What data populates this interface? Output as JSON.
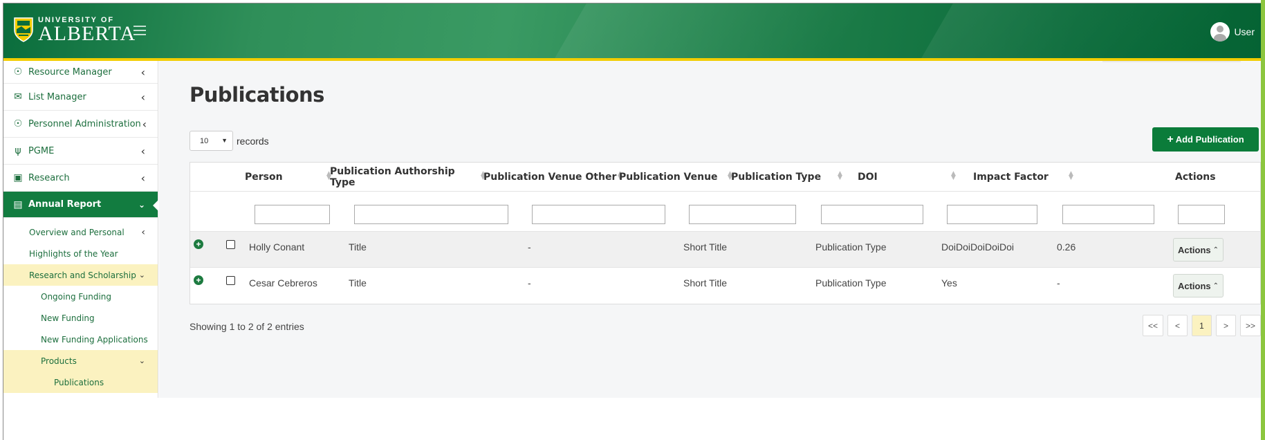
{
  "header": {
    "logo_top": "UNIVERSITY OF",
    "logo_main": "ALBERTA",
    "user_label": "User"
  },
  "sidebar": {
    "items": [
      {
        "label": "Resource Manager",
        "icon": "user-search-icon"
      },
      {
        "label": "List Manager",
        "icon": "envelope-icon"
      },
      {
        "label": "Personnel Administration",
        "icon": "user-search-icon"
      },
      {
        "label": "PGME",
        "icon": "stethoscope-icon"
      },
      {
        "label": "Research",
        "icon": "archive-icon"
      },
      {
        "label": "Annual Report",
        "icon": "book-open-icon"
      }
    ],
    "sub_items": [
      {
        "label": "Overview and Personal"
      },
      {
        "label": "Highlights of the Year"
      },
      {
        "label": "Research and Scholarship"
      },
      {
        "label": "Ongoing Funding"
      },
      {
        "label": "New Funding"
      },
      {
        "label": "New Funding Applications"
      },
      {
        "label": "Products"
      },
      {
        "label": "Publications"
      }
    ]
  },
  "main": {
    "title": "Publications",
    "records_value": "10",
    "records_label": "records",
    "add_button": "Add Publication",
    "columns": [
      "Person",
      "Publication Authorship Type",
      "Publication Venue Other",
      "Publication Venue",
      "Publication Type",
      "DOI",
      "Impact Factor",
      "Actions"
    ],
    "rows": [
      {
        "person": "Holly Conant",
        "authorship": "Title",
        "venue_other": "-",
        "venue": "Short Title",
        "type": "Publication Type",
        "doi": "DoiDoiDoiDoiDoi",
        "impact": "0.26",
        "action": "Actions"
      },
      {
        "person": "Cesar Cebreros",
        "authorship": "Title",
        "venue_other": "-",
        "venue": "Short Title",
        "type": "Publication Type",
        "doi": "Yes",
        "impact": "-",
        "action": "Actions"
      }
    ],
    "showing": "Showing 1 to 2 of 2 entries",
    "pager": [
      "<<",
      "<",
      "1",
      ">",
      ">>"
    ]
  },
  "colors": {
    "brand_green": "#0b7c3a",
    "brand_gold": "#f2cd00",
    "highlight": "#fbf2c0"
  }
}
